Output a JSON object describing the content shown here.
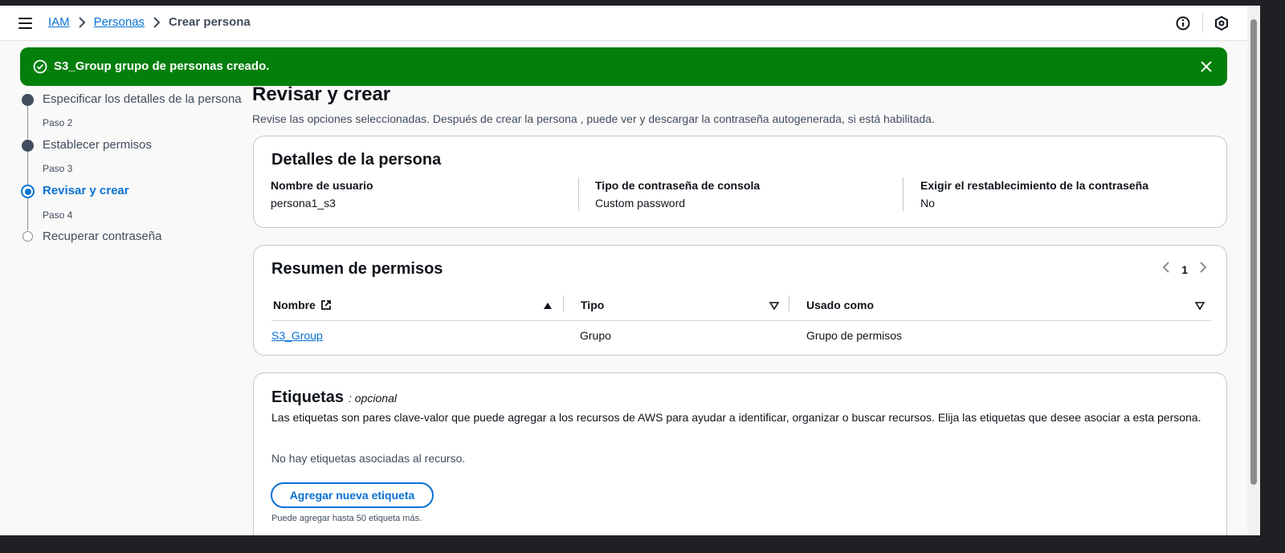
{
  "breadcrumb": {
    "items": [
      "IAM",
      "Personas"
    ],
    "current": "Crear persona"
  },
  "header_icons": [
    "info-icon",
    "settings-hexagon-icon"
  ],
  "flash": {
    "message": "S3_Group grupo de personas creado.",
    "icon": "check-circle-icon",
    "color": "#037f0c"
  },
  "steps": [
    {
      "small": "",
      "label": "Especificar los detalles de la persona",
      "state": "done"
    },
    {
      "small": "Paso 2",
      "label": "Establecer permisos",
      "state": "done"
    },
    {
      "small": "Paso 3",
      "label": "Revisar y crear",
      "state": "active"
    },
    {
      "small": "Paso 4",
      "label": "Recuperar contraseña",
      "state": "todo"
    }
  ],
  "main": {
    "title": "Revisar y crear",
    "description": "Revise las opciones seleccionadas. Después de crear la persona , puede ver y descargar la contraseña autogenerada, si está habilitada."
  },
  "details": {
    "title": "Detalles de la persona",
    "fields": [
      {
        "key": "Nombre de usuario",
        "value": "persona1_s3"
      },
      {
        "key": "Tipo de contraseña de consola",
        "value": "Custom password"
      },
      {
        "key": "Exigir el restablecimiento de la contraseña",
        "value": "No"
      }
    ]
  },
  "permissions": {
    "title": "Resumen de permisos",
    "page": "1",
    "columns": [
      "Nombre",
      "Tipo",
      "Usado como"
    ],
    "rows": [
      {
        "name": "S3_Group",
        "type": "Grupo",
        "used_as": "Grupo de permisos"
      }
    ]
  },
  "tags": {
    "title": "Etiquetas",
    "optional": ": opcional",
    "description": "Las etiquetas son pares clave-valor que puede agregar a los recursos de AWS para ayudar a identificar, organizar o buscar recursos. Elija las etiquetas que desee asociar a esta persona.",
    "empty": "No hay etiquetas asociadas al recurso.",
    "add_button": "Agregar nueva etiqueta",
    "hint": "Puede agregar hasta 50 etiqueta más."
  },
  "colors": {
    "link": "#0972d3",
    "success": "#037f0c",
    "text": "#0f141a",
    "muted": "#414d5c"
  }
}
